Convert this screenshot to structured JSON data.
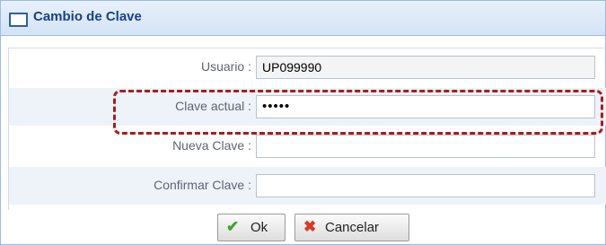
{
  "window": {
    "title": "Cambio de Clave",
    "title_icon": "window-icon"
  },
  "form": {
    "usuario": {
      "label": "Usuario :",
      "value": "UP099990"
    },
    "clave_actual": {
      "label": "Clave actual :",
      "value": "•••••"
    },
    "nueva_clave": {
      "label": "Nueva Clave :",
      "value": ""
    },
    "confirmar_clave": {
      "label": "Confirmar Clave :",
      "value": ""
    }
  },
  "buttons": {
    "ok": {
      "label": "Ok",
      "icon": "checkmark-icon"
    },
    "cancel": {
      "label": "Cancelar",
      "icon": "x-mark-icon"
    }
  },
  "colors": {
    "title_text": "#15428b",
    "highlight_border": "#b01a1a",
    "ok_icon": "#3fa52d",
    "cancel_icon": "#d93a23"
  }
}
